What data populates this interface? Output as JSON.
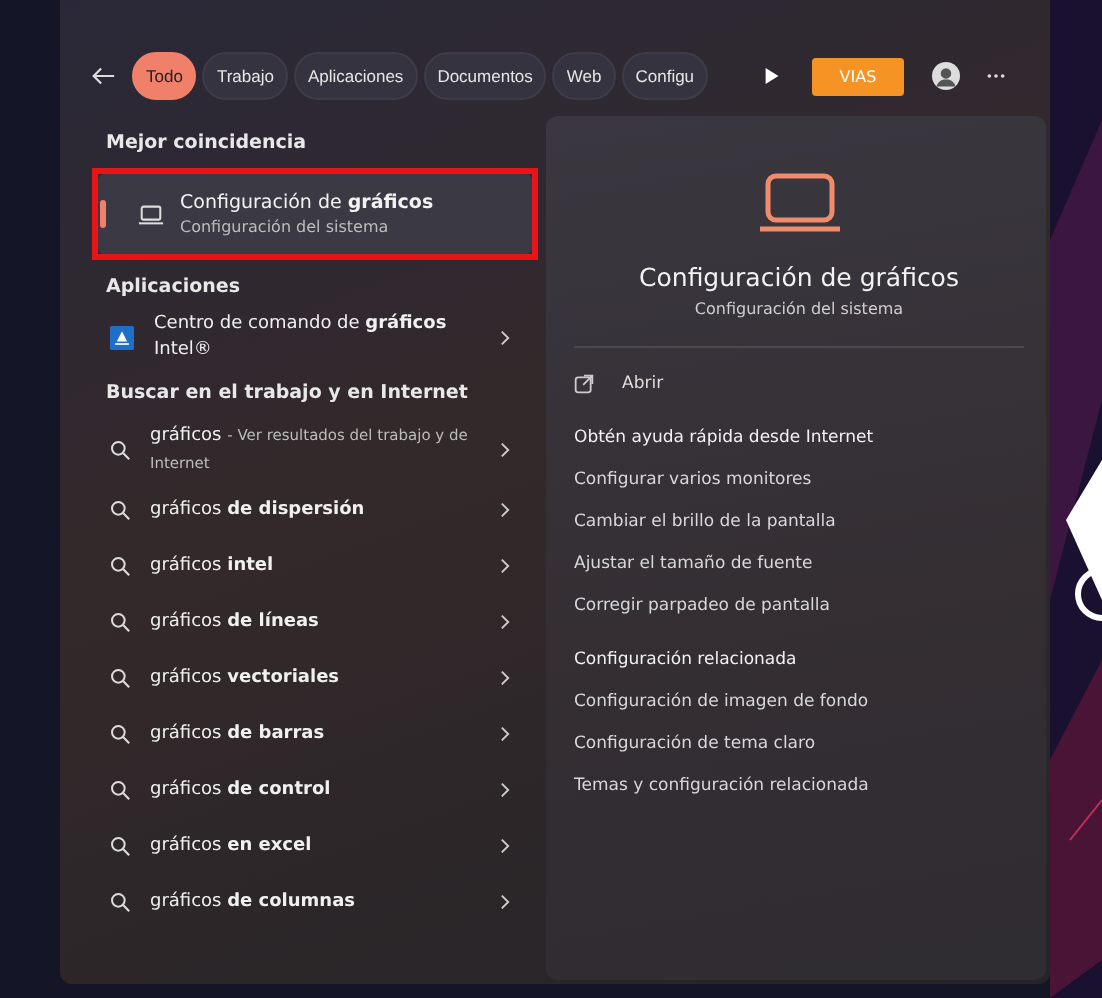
{
  "top_bar": {
    "tabs": [
      {
        "label": "Todo",
        "selected": true
      },
      {
        "label": "Trabajo",
        "selected": false
      },
      {
        "label": "Aplicaciones",
        "selected": false
      },
      {
        "label": "Documentos",
        "selected": false
      },
      {
        "label": "Web",
        "selected": false
      },
      {
        "label": "Configu",
        "selected": false
      }
    ],
    "account_button": "VIAS"
  },
  "best_match": {
    "heading": "Mejor coincidencia",
    "title": "Configuración de **gráficos**",
    "subtitle": "Configuración del sistema",
    "selected": true,
    "highlighted": true
  },
  "apps": {
    "heading": "Aplicaciones",
    "items": [
      {
        "title": "Centro de comando de **gráficos** Intel®"
      }
    ]
  },
  "web_search": {
    "heading": "Buscar en el trabajo y en Internet",
    "items": [
      {
        "kind": "web",
        "term": "gráficos",
        "hint": "- Ver resultados del trabajo y de Internet"
      },
      {
        "kind": "suggestion",
        "text": "gráficos **de dispersión**"
      },
      {
        "kind": "suggestion",
        "text": "gráficos **intel**"
      },
      {
        "kind": "suggestion",
        "text": "gráficos **de líneas**"
      },
      {
        "kind": "suggestion",
        "text": "gráficos **vectoriales**"
      },
      {
        "kind": "suggestion",
        "text": "gráficos **de barras**"
      },
      {
        "kind": "suggestion",
        "text": "gráficos **de control**"
      },
      {
        "kind": "suggestion",
        "text": "gráficos **en excel**"
      },
      {
        "kind": "suggestion",
        "text": "gráficos **de columnas**"
      }
    ]
  },
  "preview": {
    "title": "Configuración de gráficos",
    "subtitle": "Configuración del sistema",
    "open_action": "Abrir",
    "sections": [
      {
        "heading": "Obtén ayuda rápida desde Internet",
        "links": [
          "Configurar varios monitores",
          "Cambiar el brillo de la pantalla",
          "Ajustar el tamaño de fuente",
          "Corregir parpadeo de pantalla"
        ]
      },
      {
        "heading": "Configuración relacionada",
        "links": [
          "Configuración de imagen de fondo",
          "Configuración de tema claro",
          "Temas y configuración relacionada"
        ]
      }
    ]
  }
}
